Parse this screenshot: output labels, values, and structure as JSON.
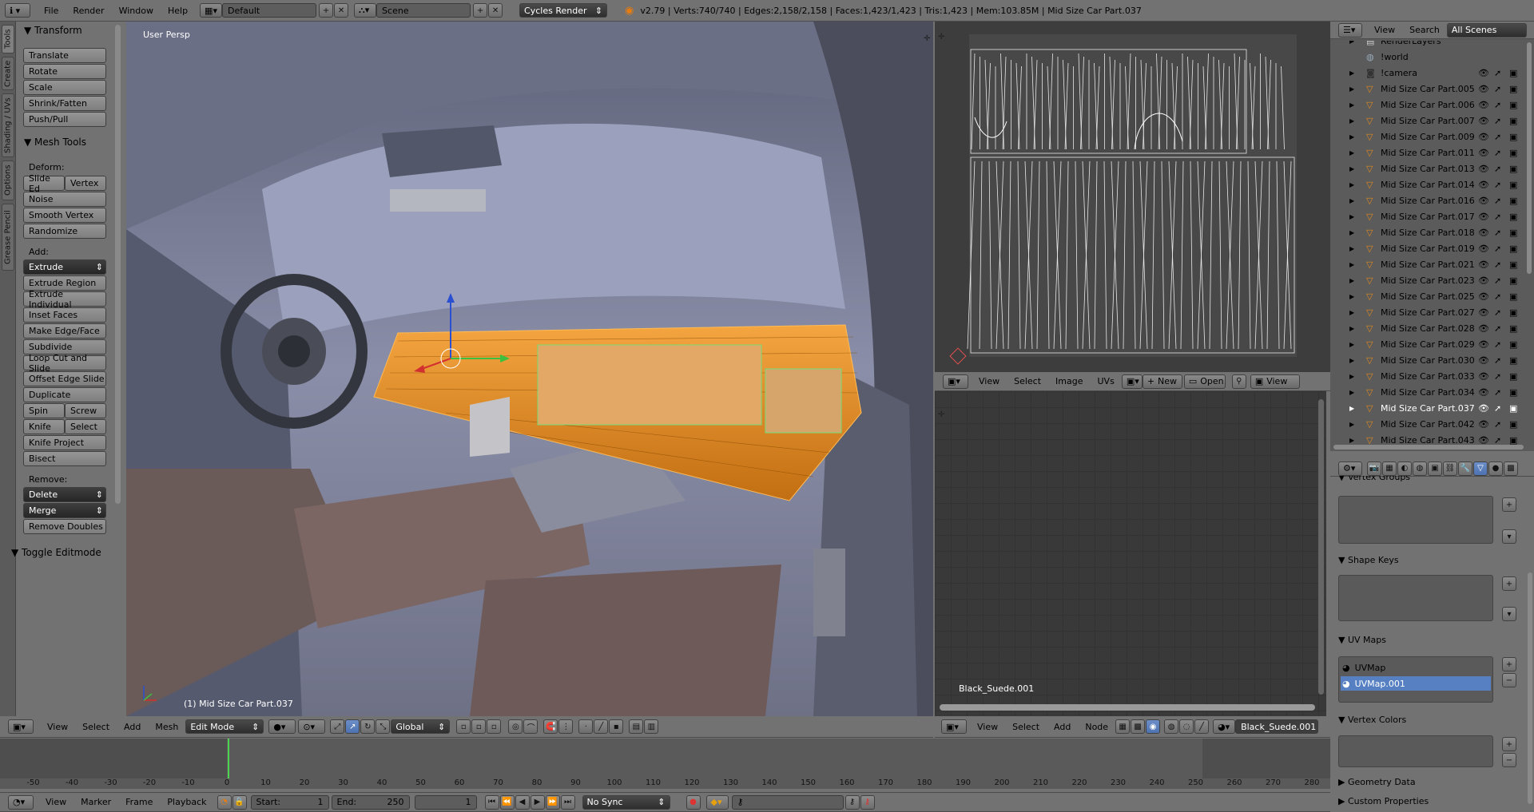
{
  "top": {
    "menus": [
      "File",
      "Render",
      "Window",
      "Help"
    ],
    "screen": "Default",
    "scene": "Scene",
    "engine": "Cycles Render",
    "stats": "v2.79 | Verts:740/740 | Edges:2,158/2,158 | Faces:1,423/1,423 | Tris:1,423 | Mem:103.85M | Mid Size Car Part.037"
  },
  "tabs": [
    "Tools",
    "Create",
    "Shading / UVs",
    "Options",
    "Grease Pencil"
  ],
  "toolshelf": {
    "transform_title": "Transform",
    "transform": [
      "Translate",
      "Rotate",
      "Scale",
      "Shrink/Fatten",
      "Push/Pull"
    ],
    "mesh_title": "Mesh Tools",
    "deform_label": "Deform:",
    "slide_edge": "Slide Ed",
    "vertex": "Vertex",
    "noise": "Noise",
    "smooth": "Smooth Vertex",
    "randomize": "Randomize",
    "add_label": "Add:",
    "extrude": "Extrude",
    "extrude_region": "Extrude Region",
    "extrude_individual": "Extrude Individual",
    "inset": "Inset Faces",
    "make_edge": "Make Edge/Face",
    "subdivide": "Subdivide",
    "loopcut": "Loop Cut and Slide",
    "offset": "Offset Edge Slide",
    "duplicate": "Duplicate",
    "spin": "Spin",
    "screw": "Screw",
    "knife": "Knife",
    "select": "Select",
    "knife_project": "Knife Project",
    "bisect": "Bisect",
    "remove_label": "Remove:",
    "delete": "Delete",
    "merge": "Merge",
    "remove_doubles": "Remove Doubles",
    "toggle": "Toggle Editmode"
  },
  "viewport": {
    "title": "User Persp",
    "object": "(1) Mid Size Car Part.037"
  },
  "view3d_header": {
    "menus": [
      "View",
      "Select",
      "Add",
      "Mesh"
    ],
    "mode": "Edit Mode",
    "orientation": "Global"
  },
  "uv_header": {
    "menus": [
      "View",
      "Select",
      "Image",
      "UVs"
    ],
    "new": "New",
    "open": "Open",
    "view": "View"
  },
  "node_header": {
    "menus": [
      "View",
      "Select",
      "Add",
      "Node"
    ],
    "material": "Black_Suede.001"
  },
  "node_label": "Black_Suede.001",
  "outliner": {
    "menus": [
      "View",
      "Search"
    ],
    "scope": "All Scenes",
    "rows": [
      "RenderLayers",
      "!world",
      "!camera",
      "Mid Size Car Part.005",
      "Mid Size Car Part.006",
      "Mid Size Car Part.007",
      "Mid Size Car Part.009",
      "Mid Size Car Part.011",
      "Mid Size Car Part.013",
      "Mid Size Car Part.014",
      "Mid Size Car Part.016",
      "Mid Size Car Part.017",
      "Mid Size Car Part.018",
      "Mid Size Car Part.019",
      "Mid Size Car Part.021",
      "Mid Size Car Part.023",
      "Mid Size Car Part.025",
      "Mid Size Car Part.027",
      "Mid Size Car Part.028",
      "Mid Size Car Part.029",
      "Mid Size Car Part.030",
      "Mid Size Car Part.033",
      "Mid Size Car Part.034",
      "Mid Size Car Part.037",
      "Mid Size Car Part.042",
      "Mid Size Car Part.043"
    ],
    "active": "Mid Size Car Part.037"
  },
  "props": {
    "vertex_groups": "Vertex Groups",
    "shape_keys": "Shape Keys",
    "uv_maps": "UV Maps",
    "uv1": "UVMap",
    "uv2": "UVMap.001",
    "vertex_colors": "Vertex Colors",
    "geometry": "Geometry Data",
    "custom": "Custom Properties"
  },
  "timeline": {
    "ticks": [
      "-50",
      "-40",
      "-30",
      "-20",
      "-10",
      "0",
      "10",
      "20",
      "30",
      "40",
      "50",
      "60",
      "70",
      "80",
      "90",
      "100",
      "110",
      "120",
      "130",
      "140",
      "150",
      "160",
      "170",
      "180",
      "190",
      "200",
      "210",
      "220",
      "230",
      "240",
      "250",
      "260",
      "270",
      "280"
    ],
    "menus": [
      "View",
      "Marker",
      "Frame",
      "Playback"
    ],
    "start_label": "Start:",
    "start": "1",
    "end_label": "End:",
    "end": "250",
    "current": "1",
    "sync": "No Sync"
  }
}
